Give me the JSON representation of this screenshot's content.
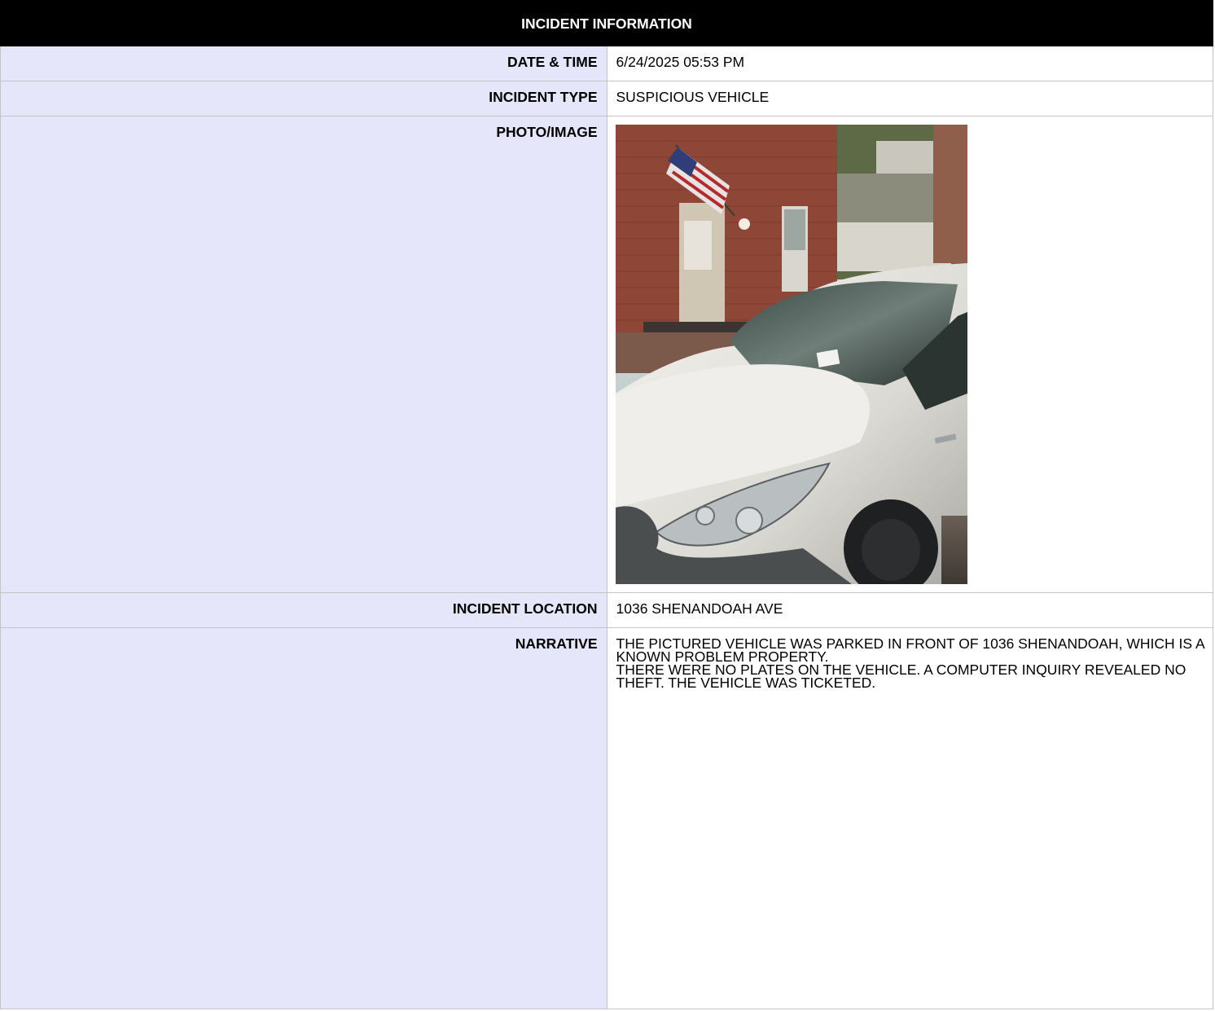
{
  "header": {
    "title": "INCIDENT INFORMATION"
  },
  "fields": {
    "date_time": {
      "label": "DATE & TIME",
      "value": "6/24/2025 05:53 PM"
    },
    "incident_type": {
      "label": "INCIDENT TYPE",
      "value": "SUSPICIOUS VEHICLE"
    },
    "photo": {
      "label": "PHOTO/IMAGE"
    },
    "incident_location": {
      "label": "INCIDENT LOCATION",
      "value": "1036 SHENANDOAH AVE"
    },
    "narrative": {
      "label": "NARRATIVE",
      "value": "THE PICTURED VEHICLE WAS PARKED IN FRONT OF 1036 SHENANDOAH, WHICH IS A KNOWN PROBLEM PROPERTY.\nTHERE WERE NO PLATES ON THE VEHICLE. A COMPUTER INQUIRY REVEALED NO THEFT. THE VEHICLE WAS TICKETED."
    }
  },
  "colors": {
    "header_background": "#000000",
    "header_text": "#ffffff",
    "label_background": "#e6e6fa",
    "border": "#c4c4c4"
  }
}
